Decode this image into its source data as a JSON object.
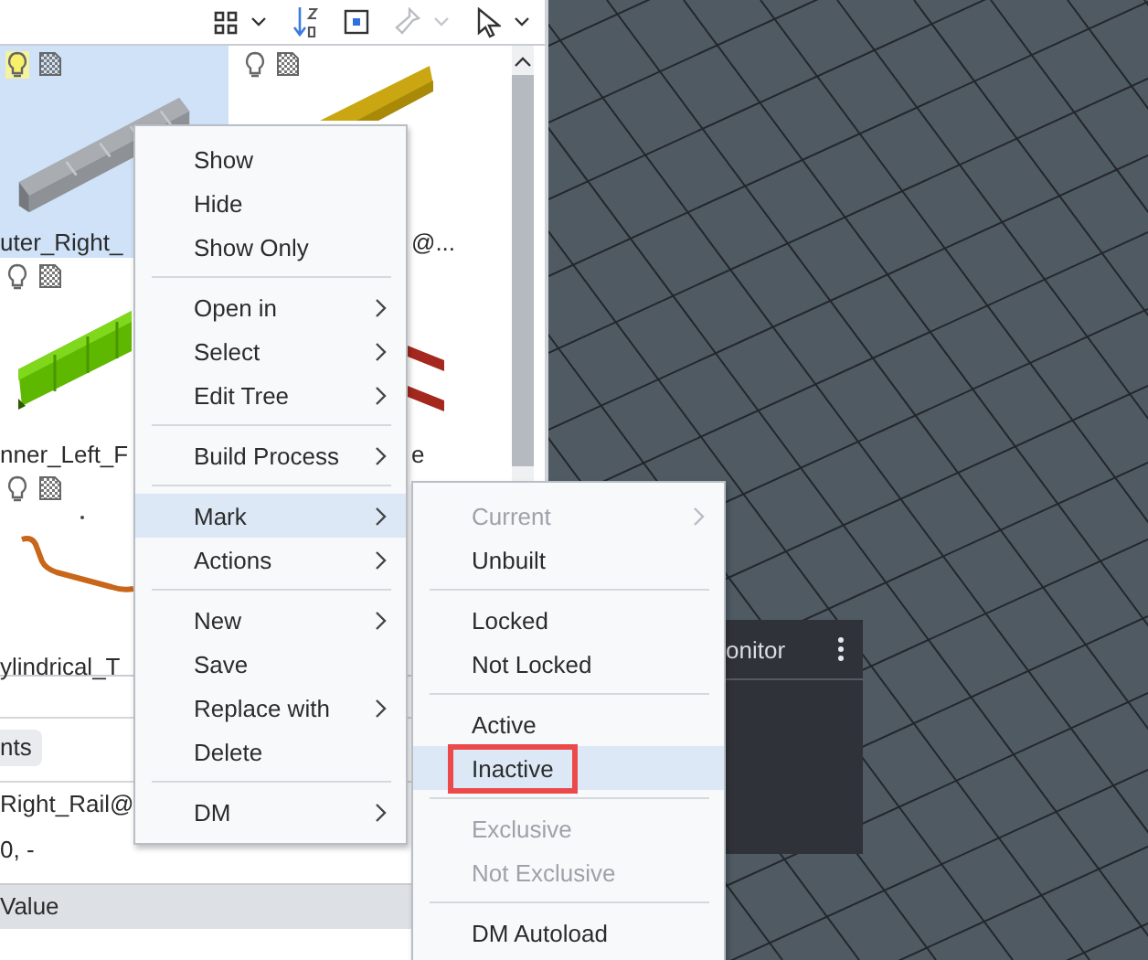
{
  "toolbar": {
    "buttons": [
      {
        "kind": "grid",
        "dropdown": true,
        "disabled": false
      },
      {
        "kind": "sort",
        "dropdown": false,
        "disabled": false
      },
      {
        "kind": "frame",
        "dropdown": false,
        "disabled": false
      },
      {
        "kind": "flashlight",
        "dropdown": true,
        "disabled": true
      },
      {
        "kind": "pointer",
        "dropdown": true,
        "disabled": false
      }
    ]
  },
  "gallery": {
    "tiles": [
      {
        "label": "uter_Right_",
        "selected": true,
        "status_icons": true,
        "kind": "grey_rail"
      },
      {
        "label": "@...",
        "selected": false,
        "status_icons": true,
        "kind": "yellow_rail"
      },
      {
        "label": "nner_Left_F",
        "selected": false,
        "status_icons": true,
        "kind": "green_rail"
      },
      {
        "label": "e",
        "selected": false,
        "kind": "red_bars"
      },
      {
        "label": "ylindrical_T",
        "selected": false,
        "status_icons": true,
        "kind": "orange_wire"
      }
    ]
  },
  "properties_panel": {
    "tab": "nts",
    "lines": [
      "Right_Rail@",
      "0, -"
    ],
    "column": "Value"
  },
  "monitor": {
    "title": "onitor"
  },
  "context_menu": {
    "groups": [
      [
        {
          "label": "Show",
          "submenu": false,
          "selected": false
        },
        {
          "label": "Hide",
          "submenu": false,
          "selected": false
        },
        {
          "label": "Show Only",
          "submenu": false,
          "selected": false
        }
      ],
      [
        {
          "label": "Open in",
          "submenu": true,
          "selected": false
        },
        {
          "label": "Select",
          "submenu": true,
          "selected": false
        },
        {
          "label": "Edit Tree",
          "submenu": true,
          "selected": false
        }
      ],
      [
        {
          "label": "Build Process",
          "submenu": true,
          "selected": false
        }
      ],
      [
        {
          "label": "Mark",
          "submenu": true,
          "selected": true
        },
        {
          "label": "Actions",
          "submenu": true,
          "selected": false
        }
      ],
      [
        {
          "label": "New",
          "submenu": true,
          "selected": false
        },
        {
          "label": "Save",
          "submenu": false,
          "selected": false
        },
        {
          "label": "Replace with",
          "submenu": true,
          "selected": false
        },
        {
          "label": "Delete",
          "submenu": false,
          "selected": false
        }
      ],
      [
        {
          "label": "DM",
          "submenu": true,
          "selected": false
        }
      ]
    ]
  },
  "submenu": {
    "groups": [
      [
        {
          "label": "Current",
          "submenu": true,
          "selected": false,
          "disabled": true,
          "outlined": false
        },
        {
          "label": "Unbuilt",
          "submenu": false,
          "selected": false,
          "disabled": false,
          "outlined": false
        }
      ],
      [
        {
          "label": "Locked",
          "submenu": false,
          "selected": false,
          "disabled": false,
          "outlined": false
        },
        {
          "label": "Not Locked",
          "submenu": false,
          "selected": false,
          "disabled": false,
          "outlined": false
        }
      ],
      [
        {
          "label": "Active",
          "submenu": false,
          "selected": false,
          "disabled": false,
          "outlined": false
        },
        {
          "label": "Inactive",
          "submenu": false,
          "selected": true,
          "disabled": false,
          "outlined": true
        }
      ],
      [
        {
          "label": "Exclusive",
          "submenu": false,
          "selected": false,
          "disabled": true,
          "outlined": false
        },
        {
          "label": "Not Exclusive",
          "submenu": false,
          "selected": false,
          "disabled": true,
          "outlined": false
        }
      ],
      [
        {
          "label": "DM Autoload",
          "submenu": false,
          "selected": false,
          "disabled": false,
          "outlined": false
        }
      ]
    ]
  }
}
